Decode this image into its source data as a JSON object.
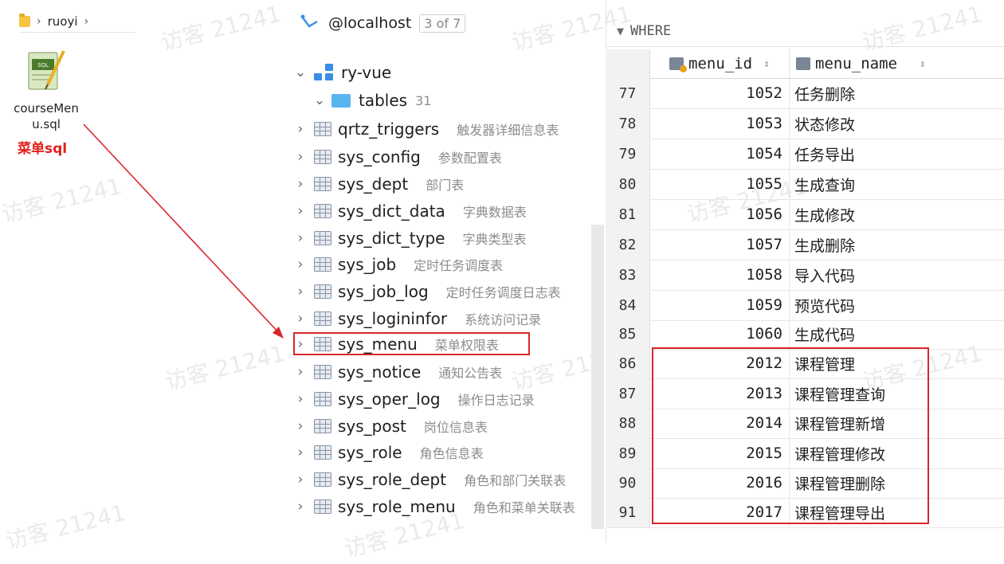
{
  "explorer": {
    "breadcrumb": [
      "ruoyi"
    ],
    "file_name": "courseMenu.sql",
    "annotation": "菜单sql"
  },
  "db": {
    "host": "@localhost",
    "host_count": "3 of 7",
    "schema": "ry-vue",
    "tables_label": "tables",
    "tables_count": "31",
    "tables": [
      {
        "name": "qrtz_triggers",
        "comment": "触发器详细信息表"
      },
      {
        "name": "sys_config",
        "comment": "参数配置表"
      },
      {
        "name": "sys_dept",
        "comment": "部门表"
      },
      {
        "name": "sys_dict_data",
        "comment": "字典数据表"
      },
      {
        "name": "sys_dict_type",
        "comment": "字典类型表"
      },
      {
        "name": "sys_job",
        "comment": "定时任务调度表"
      },
      {
        "name": "sys_job_log",
        "comment": "定时任务调度日志表"
      },
      {
        "name": "sys_logininfor",
        "comment": "系统访问记录"
      },
      {
        "name": "sys_menu",
        "comment": "菜单权限表"
      },
      {
        "name": "sys_notice",
        "comment": "通知公告表"
      },
      {
        "name": "sys_oper_log",
        "comment": "操作日志记录"
      },
      {
        "name": "sys_post",
        "comment": "岗位信息表"
      },
      {
        "name": "sys_role",
        "comment": "角色信息表"
      },
      {
        "name": "sys_role_dept",
        "comment": "角色和部门关联表"
      },
      {
        "name": "sys_role_menu",
        "comment": "角色和菜单关联表"
      }
    ]
  },
  "grid": {
    "filter_label": "WHERE",
    "columns": [
      "menu_id",
      "menu_name"
    ],
    "rows": [
      {
        "n": "77",
        "id": "1052",
        "name": "任务删除"
      },
      {
        "n": "78",
        "id": "1053",
        "name": "状态修改"
      },
      {
        "n": "79",
        "id": "1054",
        "name": "任务导出"
      },
      {
        "n": "80",
        "id": "1055",
        "name": "生成查询"
      },
      {
        "n": "81",
        "id": "1056",
        "name": "生成修改"
      },
      {
        "n": "82",
        "id": "1057",
        "name": "生成删除"
      },
      {
        "n": "83",
        "id": "1058",
        "name": "导入代码"
      },
      {
        "n": "84",
        "id": "1059",
        "name": "预览代码"
      },
      {
        "n": "85",
        "id": "1060",
        "name": "生成代码"
      },
      {
        "n": "86",
        "id": "2012",
        "name": "课程管理"
      },
      {
        "n": "87",
        "id": "2013",
        "name": "课程管理查询"
      },
      {
        "n": "88",
        "id": "2014",
        "name": "课程管理新增"
      },
      {
        "n": "89",
        "id": "2015",
        "name": "课程管理修改"
      },
      {
        "n": "90",
        "id": "2016",
        "name": "课程管理删除"
      },
      {
        "n": "91",
        "id": "2017",
        "name": "课程管理导出"
      }
    ]
  },
  "watermark": "访客 21241",
  "colors": {
    "highlight": "#d9262b",
    "annotation": "#e0201c",
    "folder": "#5ab4f0"
  }
}
